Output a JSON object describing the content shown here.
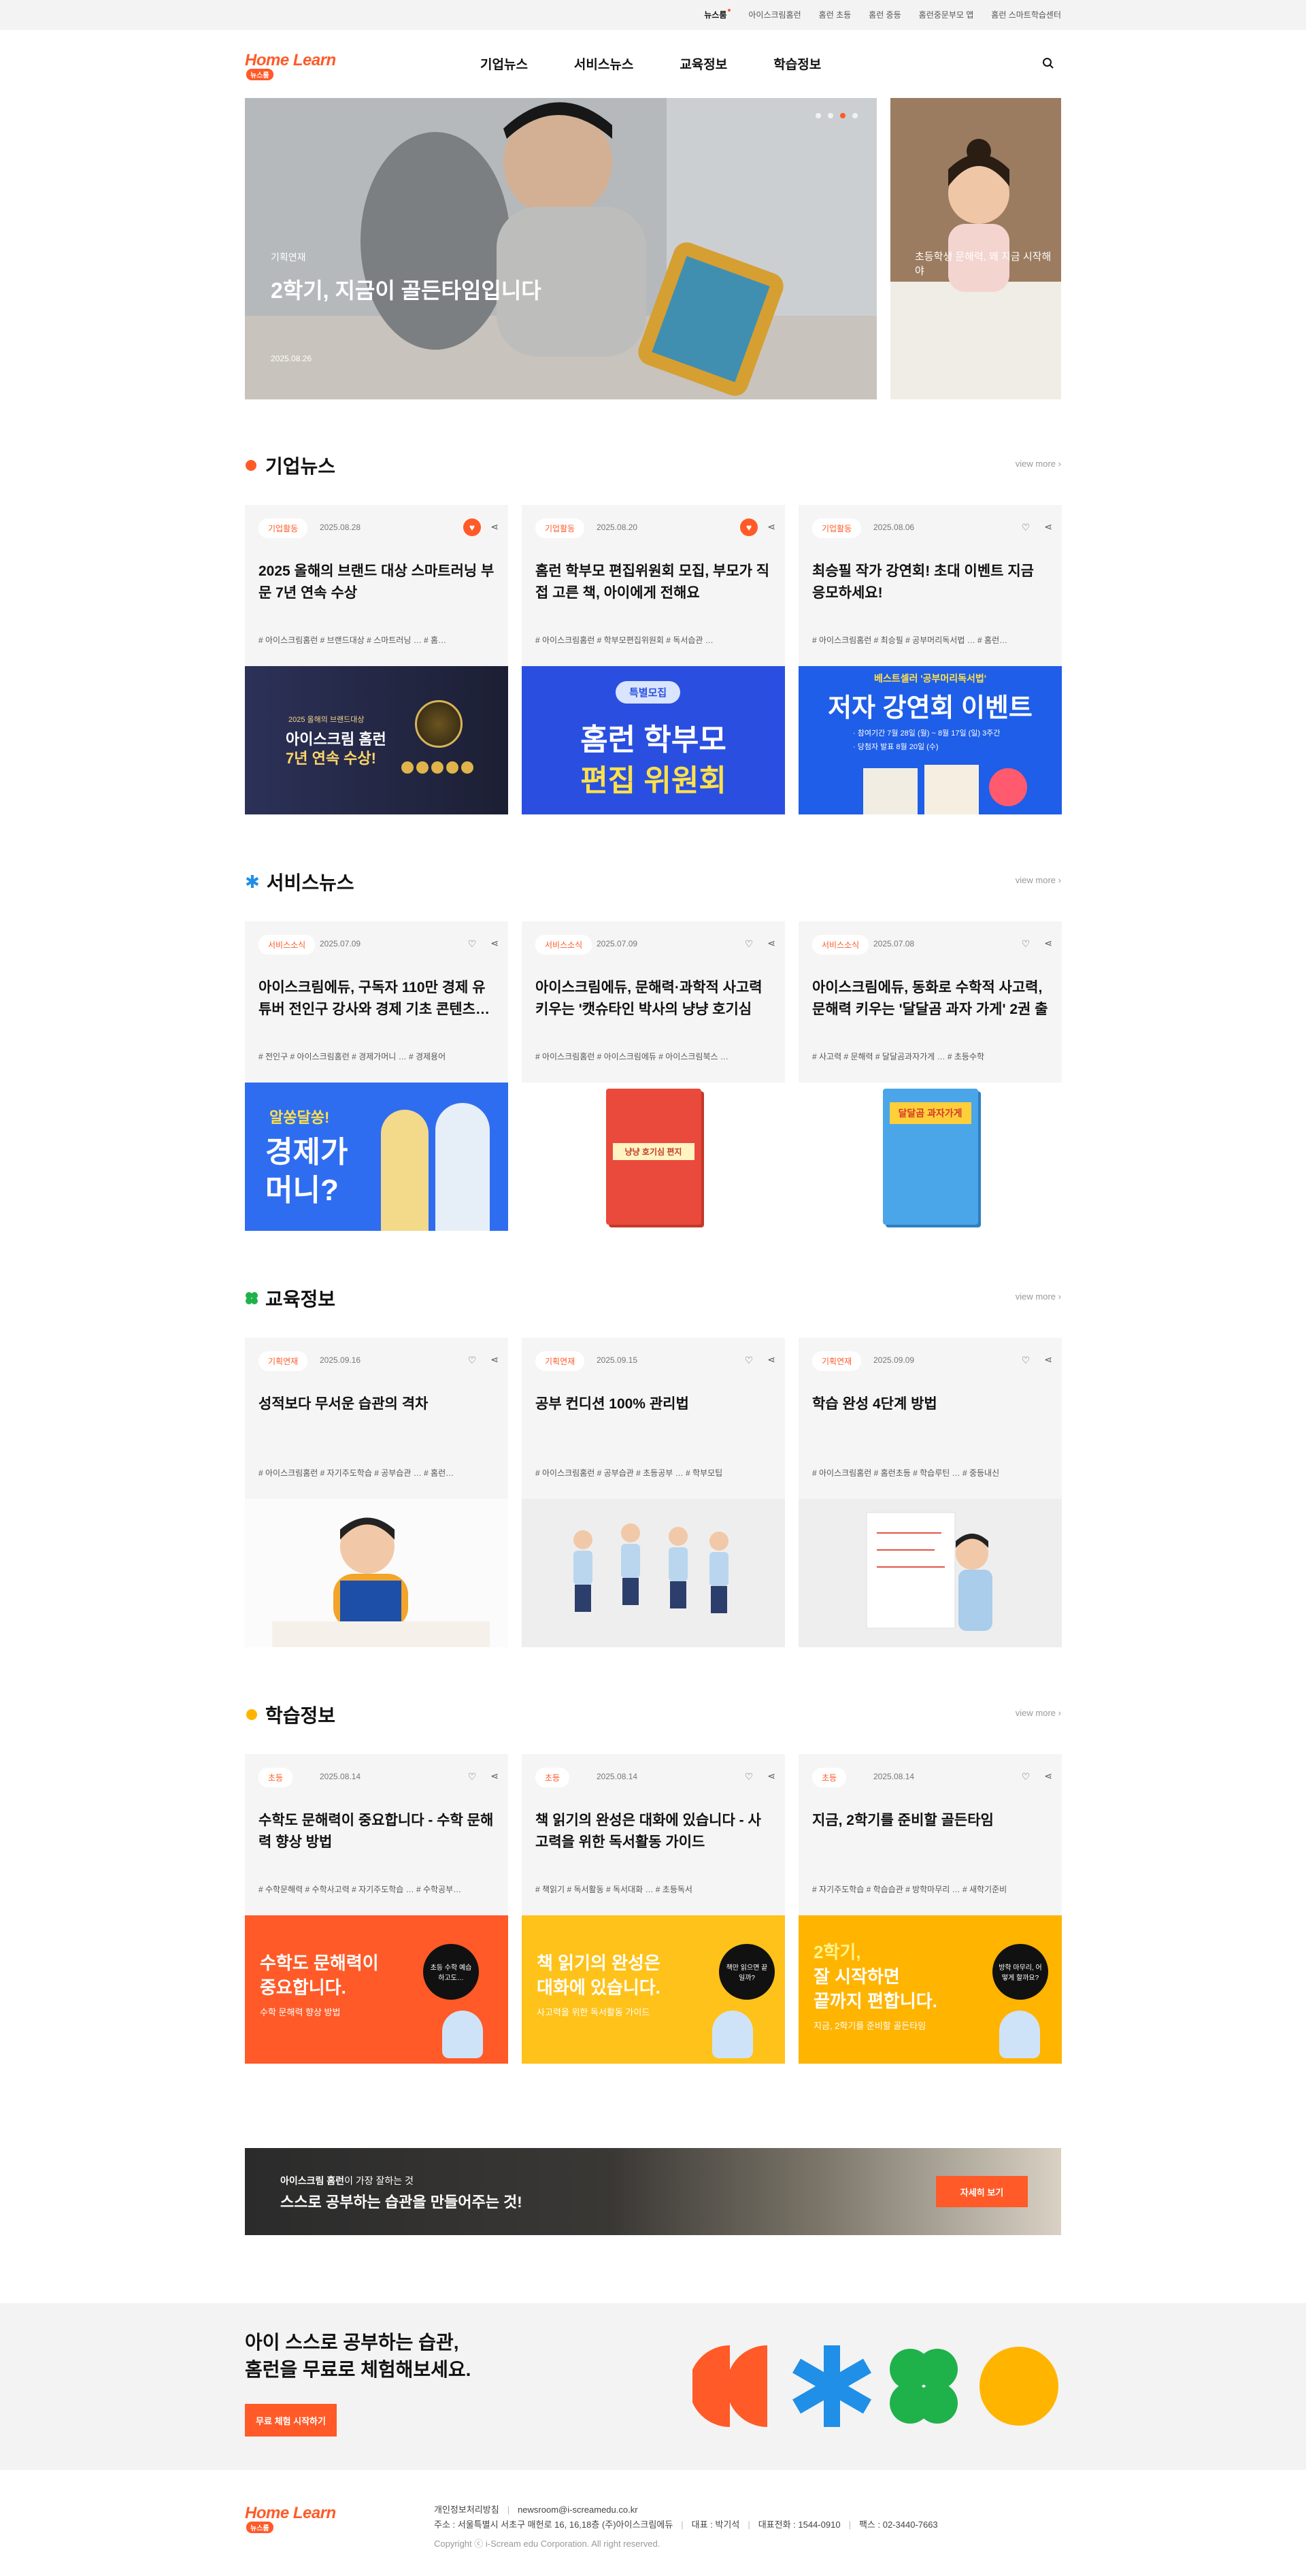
{
  "topbar": {
    "links": [
      {
        "label": "뉴스룸",
        "active": true
      },
      {
        "label": "아이스크림홈런"
      },
      {
        "label": "홈런 초등"
      },
      {
        "label": "홈런 중등"
      },
      {
        "label": "홈런중문부모 앱"
      },
      {
        "label": "홈런 스마트학습센터"
      }
    ]
  },
  "header": {
    "logo_text": "Home Learn",
    "logo_tag": "뉴스룸",
    "nav": [
      "기업뉴스",
      "서비스뉴스",
      "교육정보",
      "학습정보"
    ]
  },
  "hero": {
    "main": {
      "category": "기획연재",
      "title": "2학기, 지금이 골든타임입니다",
      "date": "2025.08.26"
    },
    "side": {
      "title": "초등학생 문해력, 왜 지금 시작해야"
    },
    "slides": 4,
    "active_slide": 3
  },
  "sections": [
    {
      "title": "기업뉴스",
      "icon": "half-circle-icon",
      "more": "view more",
      "cards": [
        {
          "badge": "기업활동",
          "date": "2025.08.28",
          "liked": true,
          "title": "2025 올해의 브랜드 대상 스마트러닝 부문 7년 연속 수상",
          "tags": "# 아이스크림홈런   # 브랜드대상   # 스마트러닝   …   # 홈…",
          "image": "award",
          "image_text": [
            "2025 올해의 브랜드대상",
            "아이스크림 홈런",
            "7년 연속 수상!"
          ]
        },
        {
          "badge": "기업활동",
          "date": "2025.08.20",
          "liked": true,
          "title": "홈런 학부모 편집위원회 모집, 부모가 직접 고른 책, 아이에게 전해요",
          "tags": "# 아이스크림홈런   # 학부모편집위원회   # 독서습관   …",
          "image": "committee",
          "image_text": [
            "특별모집",
            "홈런 학부모",
            "편집 위원회"
          ]
        },
        {
          "badge": "기업활동",
          "date": "2025.08.06",
          "liked": false,
          "title": "최승필 작가 강연회! 초대 이벤트 지금 응모하세요!",
          "tags": "# 아이스크림홈런   # 최승필   # 공부머리독서법   …   # 홈런…",
          "image": "lecture",
          "image_text": [
            "베스트셀러 '공부머리독서법'",
            "저자 강연회 이벤트",
            "· 참여기간   7월 28일 (월) ~ 8월 17일 (일) 3주간",
            "· 당첨자 발표   8월 20일 (수)"
          ]
        }
      ]
    },
    {
      "title": "서비스뉴스",
      "icon": "asterisk-icon",
      "more": "view more",
      "cards": [
        {
          "badge": "서비스소식",
          "date": "2025.07.09",
          "liked": false,
          "title": "아이스크림에듀, 구독자 110만 경제 유튜버 전인구 강사와 경제 기초 콘텐츠…",
          "tags": "# 전인구   # 아이스크림홈런   # 경제가머니   …   # 경제용어",
          "image": "economy",
          "image_text": [
            "알쏭달쏭!",
            "경제가",
            "머니?"
          ]
        },
        {
          "badge": "서비스소식",
          "date": "2025.07.09",
          "liked": false,
          "title": "아이스크림에듀, 문해력·과학적 사고력 키우는 '캣슈타인 박사의 냥냥 호기심 편…",
          "tags": "# 아이스크림홈런   # 아이스크림에듀   # 아이스크림북스   …",
          "image": "book-red",
          "image_text": [
            "냥냥 호기심 편지"
          ]
        },
        {
          "badge": "서비스소식",
          "date": "2025.07.08",
          "liked": false,
          "title": "아이스크림에듀, 동화로 수학적 사고력, 문해력 키우는 '달달곰 과자 가게' 2권 출간",
          "tags": "# 사고력   # 문해력   # 달달곰과자가게   …   # 초등수학",
          "image": "book-blue",
          "image_text": [
            "달달곰 과자가게"
          ]
        }
      ]
    },
    {
      "title": "교육정보",
      "icon": "clover-icon",
      "more": "view more",
      "cards": [
        {
          "badge": "기획연재",
          "date": "2025.09.16",
          "liked": false,
          "title": "성적보다 무서운 습관의 격차",
          "tags": "# 아이스크림홈런   # 자기주도학습   # 공부습관   …   # 홈런…",
          "image": "photo-boy",
          "image_text": []
        },
        {
          "badge": "기획연재",
          "date": "2025.09.15",
          "liked": false,
          "title": "공부 컨디션 100% 관리법",
          "tags": "# 아이스크림홈런   # 공부습관   # 초등공부   …   # 학부모팁",
          "image": "photo-kids",
          "image_text": []
        },
        {
          "badge": "기획연재",
          "date": "2025.09.09",
          "liked": false,
          "title": "학습 완성 4단계 방법",
          "tags": "# 아이스크림홈런   # 홈런초등   # 학습루틴   …   # 중등내신",
          "image": "photo-paper",
          "image_text": []
        }
      ]
    },
    {
      "title": "학습정보",
      "icon": "circle-icon",
      "more": "view more",
      "cards": [
        {
          "badge": "초등",
          "date": "2025.08.14",
          "liked": false,
          "title": "수학도 문해력이 중요합니다 - 수학 문해력 향상 방법",
          "tags": "# 수학문해력   # 수학사고력   # 자기주도학습   …   # 수학공부…",
          "image": "orange-ad",
          "image_text": [
            "수학도 문해력이",
            "중요합니다.",
            "수학 문해력 향상 방법",
            "초등 수학 예습하고도…"
          ]
        },
        {
          "badge": "초등",
          "date": "2025.08.14",
          "liked": false,
          "title": "책 읽기의 완성은 대화에 있습니다 - 사고력을 위한 독서활동 가이드",
          "tags": "# 책읽기   # 독서활동   # 독서대화   …   # 초등독서",
          "image": "yellow-ad",
          "image_text": [
            "책 읽기의 완성은",
            "대화에 있습니다.",
            "사고력을 위한 독서활동 가이드",
            "책만 읽으면 끝일까?"
          ]
        },
        {
          "badge": "초등",
          "date": "2025.08.14",
          "liked": false,
          "title": "지금, 2학기를 준비할 골든타임",
          "tags": "# 자기주도학습   # 학습습관   # 방학마무리   …   # 새학기준비",
          "image": "gold-ad",
          "image_text": [
            "2학기,",
            "잘 시작하면",
            "끝까지 편합니다.",
            "지금, 2학기를 준비할 골든타임",
            "방학 마무리, 어떻게 할까요?"
          ]
        }
      ]
    }
  ],
  "banner": {
    "line1_brand": "아이스크림 홈런",
    "line1_rest": "이 가장 잘하는 것",
    "line2": "스스로 공부하는 습관을 만들어주는 것!",
    "button": "자세히 보기"
  },
  "trial": {
    "line1": "아이 스스로 공부하는 습관,",
    "line2": "홈런을 무료로 체험해보세요.",
    "button": "무료 체험 시작하기",
    "colors": [
      "#ff5a28",
      "#1f8fe8",
      "#1fb24a",
      "#ffb400"
    ]
  },
  "footer": {
    "logo_text": "Home Learn",
    "logo_tag": "뉴스룸",
    "privacy": "개인정보처리방침",
    "email": "newsroom@i-screamedu.co.kr",
    "address": "주소 : 서울특별시 서초구 매헌로 16, 16,18층 (주)아이스크림에듀",
    "ceo": "대표 : 박기석",
    "phone": "대표전화 : 1544-0910",
    "fax": "팩스 : 02-3440-7663",
    "copyright": "Copyright ⓒ i-Scream edu Corporation. All right reserved."
  },
  "colors": {
    "accent": "#ff5a28",
    "card_bg": "#f5f5f5"
  }
}
